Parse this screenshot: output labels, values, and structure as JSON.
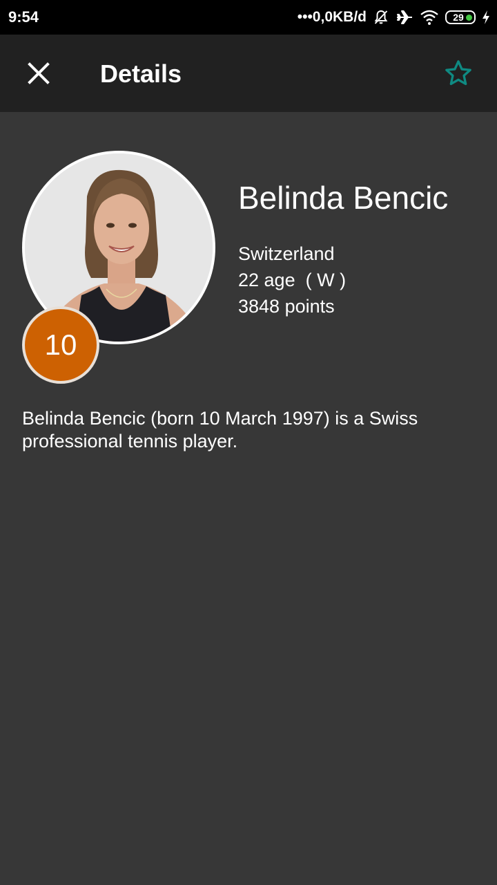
{
  "status_bar": {
    "time": "9:54",
    "network_speed": "•••0,0KB/d",
    "battery_level": "29",
    "icons": [
      "notifications-off-icon",
      "airplane-mode-icon",
      "wifi-icon",
      "battery-icon",
      "charging-bolt-icon"
    ]
  },
  "app_bar": {
    "title": "Details",
    "close_icon": "close-icon",
    "favorite_icon": "star-outline-icon",
    "favorite_color": "#0f8a82"
  },
  "player": {
    "name": "Belinda Bencic",
    "country": "Switzerland",
    "age_line": "22 age  ( W )",
    "points_line": "3848 points",
    "rank": "10",
    "rank_badge_color": "#cd6102",
    "bio": "Belinda Bencic (born 10 March 1997) is a Swiss professional tennis player."
  },
  "colors": {
    "background": "#373737",
    "app_bar": "#212121",
    "status_bar": "#000000"
  }
}
